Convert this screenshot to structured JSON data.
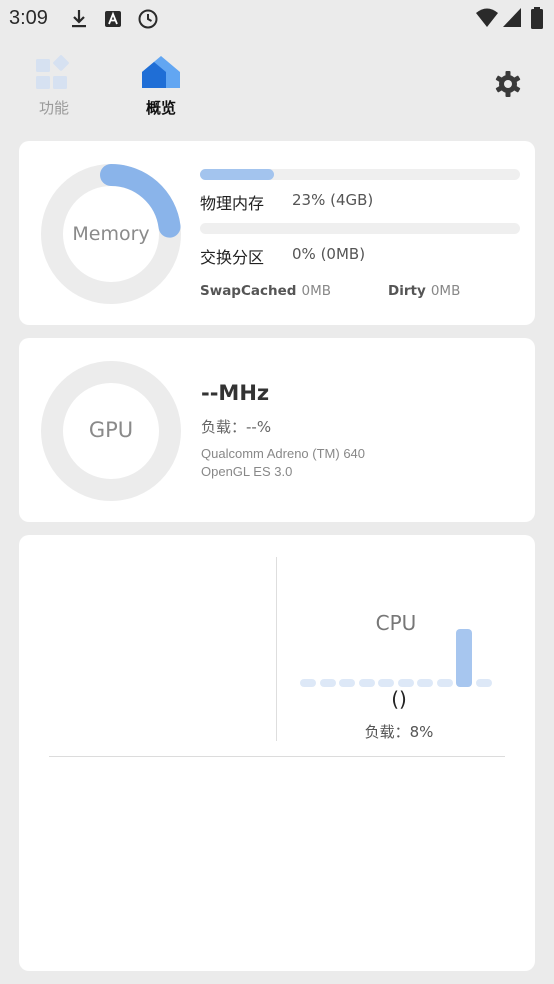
{
  "status_bar": {
    "time": "3:09",
    "left_icons": [
      "download-icon",
      "font-a-icon",
      "clock-icon"
    ],
    "right_icons": [
      "wifi-icon",
      "signal-icon",
      "battery-icon"
    ]
  },
  "nav": {
    "tabs": [
      {
        "label": "功能",
        "icon": "grid-blocks-icon",
        "active": false
      },
      {
        "label": "概览",
        "icon": "home-icon",
        "active": true
      }
    ],
    "settings_icon": "gear-icon",
    "active_color": "#111111",
    "inactive_color": "#9a9a9a"
  },
  "memory": {
    "ring_label": "Memory",
    "ring_fraction": 0.23,
    "physical": {
      "label": "物理内存",
      "value": "23% (4GB)",
      "fraction": 0.23
    },
    "swap": {
      "label": "交换分区",
      "value": "0% (0MB)",
      "fraction": 0.0
    },
    "swap_cached": {
      "key": "SwapCached",
      "value": "0MB"
    },
    "dirty": {
      "key": "Dirty",
      "value": "0MB"
    },
    "accent": "#8ab4ea"
  },
  "gpu": {
    "ring_label": "GPU",
    "freq": "--MHz",
    "load": "负载：--%",
    "renderer": "Qualcomm Adreno (TM) 640",
    "api": "OpenGL ES 3.0"
  },
  "cpu": {
    "title": "CPU",
    "freq": "()",
    "load": "负载：8%",
    "core_levels": [
      0.05,
      0.05,
      0.05,
      0.05,
      0.05,
      0.05,
      0.05,
      0.05,
      1.0,
      0.12
    ],
    "accent": "#a7c6ef",
    "idle": "#dde8f7"
  }
}
